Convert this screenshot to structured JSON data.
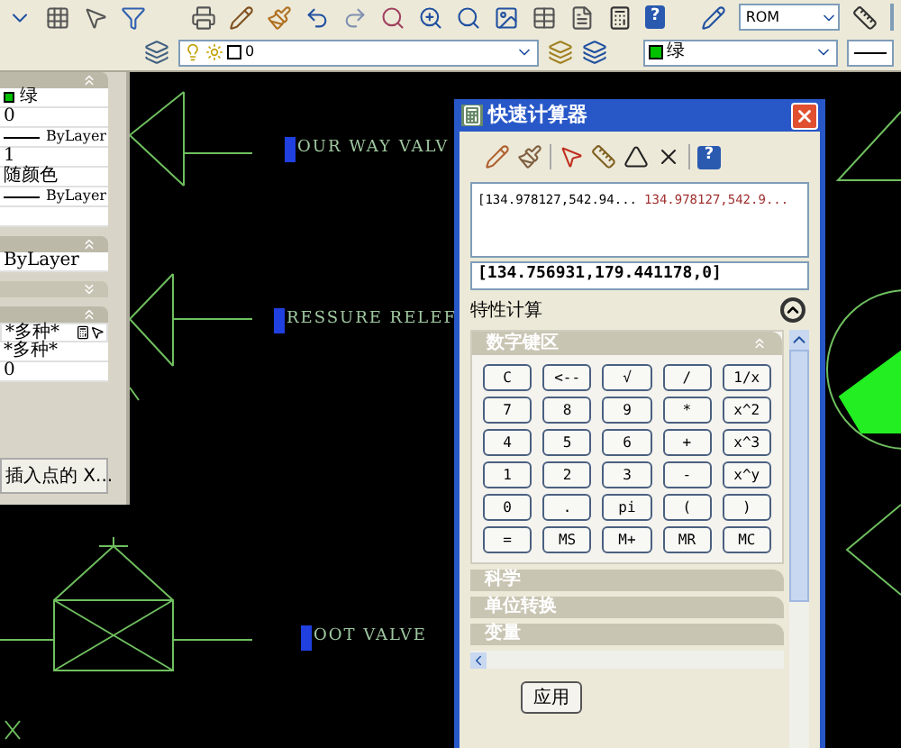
{
  "toolbar": {
    "text_style": "ROM",
    "layer": "0",
    "color_label": "绿",
    "help": "?"
  },
  "properties": {
    "sections": [
      {
        "expanded": true,
        "rows": [
          {
            "kind": "swatch",
            "text": "绿"
          },
          {
            "kind": "text",
            "text": "0"
          },
          {
            "kind": "line",
            "text": "ByLayer"
          },
          {
            "kind": "text",
            "text": "1"
          },
          {
            "kind": "text",
            "text": "随颜色"
          },
          {
            "kind": "line",
            "text": "ByLayer"
          },
          {
            "kind": "blank"
          }
        ]
      },
      {
        "expanded": true,
        "rows": [
          {
            "kind": "text",
            "text": "ByLayer"
          }
        ]
      },
      {
        "expanded": false
      },
      {
        "expanded": true,
        "rows": [
          {
            "kind": "calc",
            "text": "*多种*"
          },
          {
            "kind": "text",
            "text": "*多种*"
          },
          {
            "kind": "text",
            "text": "0"
          }
        ]
      }
    ],
    "button": "插入点的 X..."
  },
  "drawing_labels": [
    "OUR WAY VALV",
    "RESSURE RELEF",
    "OOT VALVE"
  ],
  "calculator": {
    "title": "快速计算器",
    "history": [
      {
        "expression": "[134.978127,542.94...",
        "result": "134.978127,542.9..."
      }
    ],
    "input": "[134.756931,179.441178,0]",
    "property_calc": "特性计算",
    "help": "?",
    "keypad": {
      "title": "数字键区",
      "expanded": true,
      "keys": [
        "C",
        "<--",
        "√",
        "/",
        "1/x",
        "7",
        "8",
        "9",
        "*",
        "x^2",
        "4",
        "5",
        "6",
        "+",
        "x^3",
        "1",
        "2",
        "3",
        "-",
        "x^y",
        "0",
        ".",
        "pi",
        "(",
        ")",
        "=",
        "MS",
        "M+",
        "MR",
        "MC"
      ]
    },
    "sections": [
      "科学",
      "单位转换",
      "变量"
    ],
    "buttons": [
      "应用"
    ]
  }
}
